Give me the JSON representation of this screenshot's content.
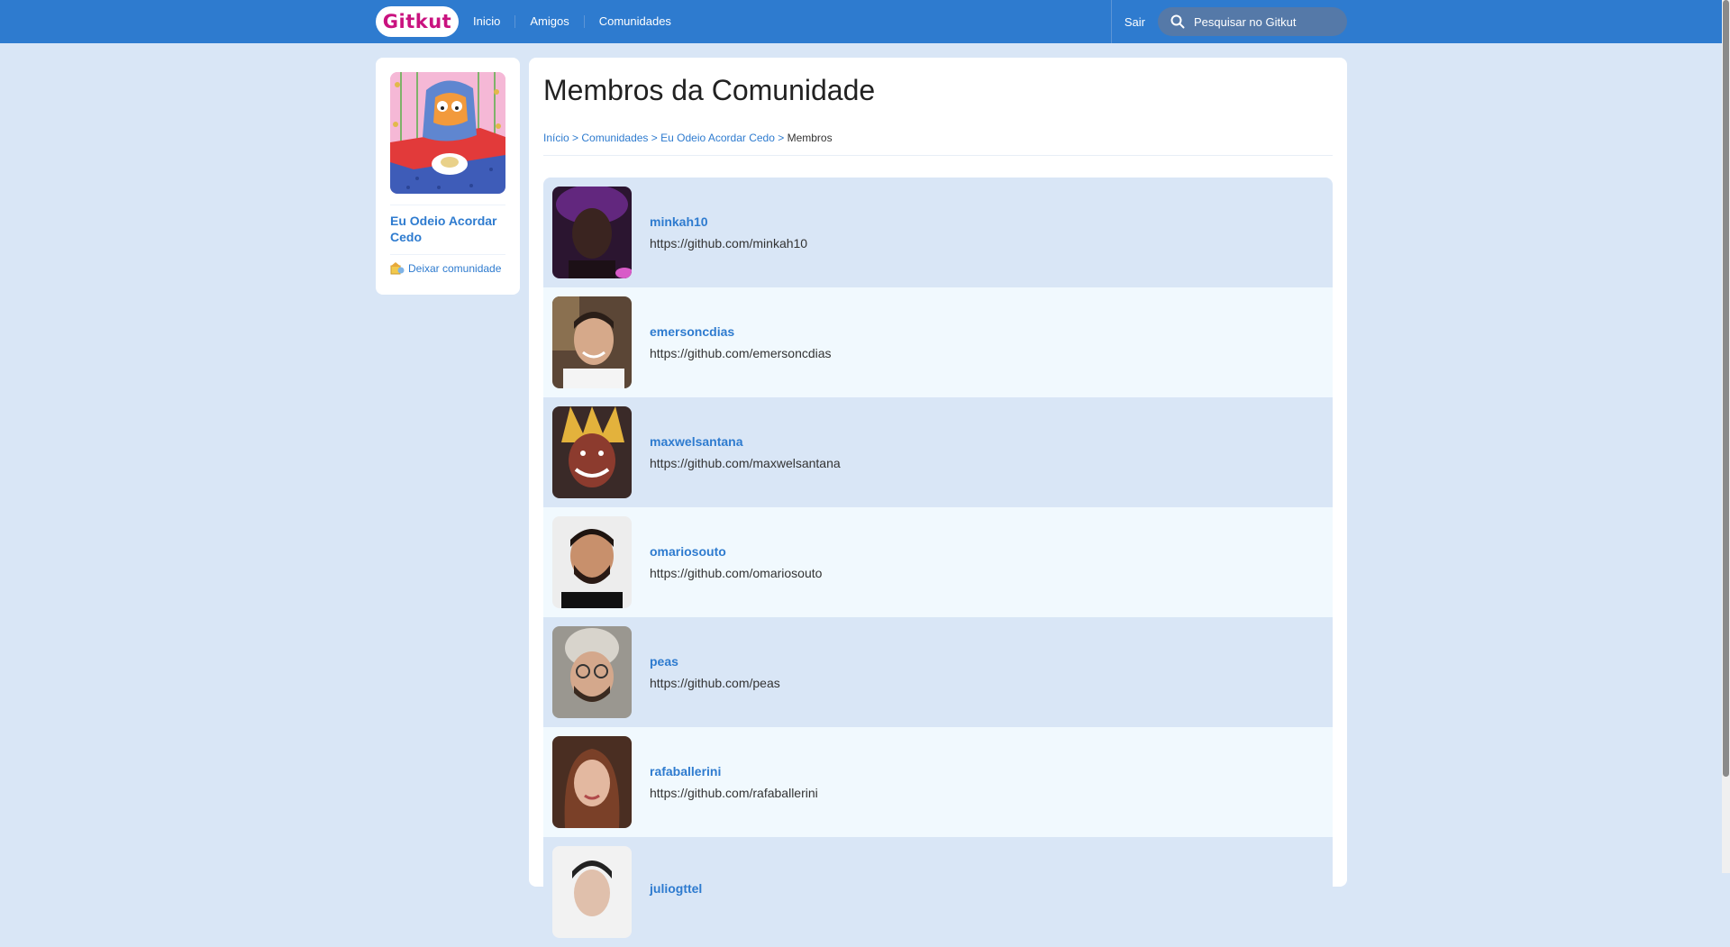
{
  "header": {
    "logo": "Gitkut",
    "nav": [
      "Inicio",
      "Amigos",
      "Comunidades"
    ],
    "logout": "Sair",
    "search_placeholder": "Pesquisar no Gitkut"
  },
  "sidebar": {
    "community_name": "Eu Odeio Acordar Cedo",
    "leave_label": "Deixar comunidade"
  },
  "main": {
    "title": "Membros da Comunidade",
    "breadcrumb": {
      "items": [
        "Início",
        "Comunidades",
        "Eu Odeio Acordar Cedo"
      ],
      "separator": ">",
      "current": "Membros"
    },
    "members": [
      {
        "name": "minkah10",
        "url": "https://github.com/minkah10"
      },
      {
        "name": "emersoncdias",
        "url": "https://github.com/emersoncdias"
      },
      {
        "name": "maxwelsantana",
        "url": "https://github.com/maxwelsantana"
      },
      {
        "name": "omariosouto",
        "url": "https://github.com/omariosouto"
      },
      {
        "name": "peas",
        "url": "https://github.com/peas"
      },
      {
        "name": "rafaballerini",
        "url": "https://github.com/rafaballerini"
      },
      {
        "name": "juliogttel",
        "url": ""
      }
    ]
  },
  "colors": {
    "header_bg": "#2E7BCF",
    "page_bg": "#D9E6F6",
    "link": "#2E7BCF",
    "logo": "#C9127F",
    "row_odd": "#D9E6F6",
    "row_even": "#F1F9FE"
  }
}
